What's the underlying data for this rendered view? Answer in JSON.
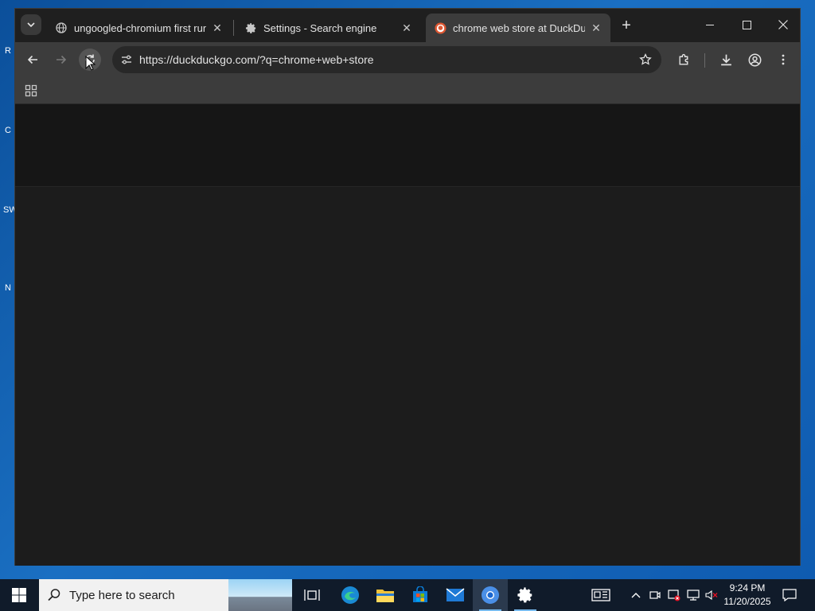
{
  "browser": {
    "tabs": [
      {
        "title": "ungoogled-chromium first run page",
        "icon": "globe-icon",
        "active": false
      },
      {
        "title": "Settings - Search engine",
        "icon": "gear-icon",
        "active": false
      },
      {
        "title": "chrome web store at DuckDuckGo",
        "icon": "duckduckgo-icon",
        "active": true
      }
    ],
    "address_bar": {
      "url": "https://duckduckgo.com/?q=chrome+web+store"
    },
    "colors": {
      "frame": "#1f1f1f",
      "toolbar": "#3c3c3c",
      "content": "#1c1c1c",
      "ddg_orange": "#de5833"
    }
  },
  "desktop": {
    "icon_fragments": [
      "R",
      "C",
      "SW",
      "N"
    ]
  },
  "taskbar": {
    "search_placeholder": "Type here to search",
    "apps": [
      "task-view-icon",
      "edge-icon",
      "file-explorer-icon",
      "store-icon",
      "mail-icon",
      "chromium-icon",
      "settings-icon"
    ],
    "clock": {
      "time": "9:24 PM",
      "date": "11/20/2025"
    }
  }
}
